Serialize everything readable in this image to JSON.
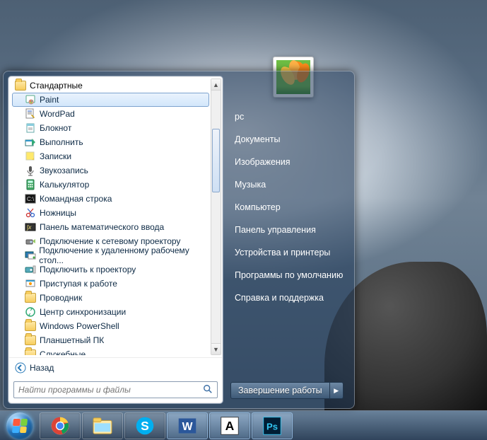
{
  "start_menu": {
    "current_folder": "Стандартные",
    "programs": [
      {
        "label": "Paint",
        "icon": "paint-icon",
        "selected": true
      },
      {
        "label": "WordPad",
        "icon": "wordpad-icon"
      },
      {
        "label": "Блокнот",
        "icon": "notepad-icon"
      },
      {
        "label": "Выполнить",
        "icon": "run-icon"
      },
      {
        "label": "Записки",
        "icon": "sticky-notes-icon"
      },
      {
        "label": "Звукозапись",
        "icon": "sound-recorder-icon"
      },
      {
        "label": "Калькулятор",
        "icon": "calculator-icon"
      },
      {
        "label": "Командная строка",
        "icon": "cmd-icon"
      },
      {
        "label": "Ножницы",
        "icon": "snipping-tool-icon"
      },
      {
        "label": "Панель математического ввода",
        "icon": "math-input-icon"
      },
      {
        "label": "Подключение к сетевому проектору",
        "icon": "network-projector-icon"
      },
      {
        "label": "Подключение к удаленному рабочему стол...",
        "icon": "remote-desktop-icon"
      },
      {
        "label": "Подключить к проектору",
        "icon": "projector-icon"
      },
      {
        "label": "Приступая к работе",
        "icon": "getting-started-icon"
      },
      {
        "label": "Проводник",
        "icon": "explorer-icon"
      },
      {
        "label": "Центр синхронизации",
        "icon": "sync-center-icon"
      },
      {
        "label": "Windows PowerShell",
        "icon": "folder-icon"
      },
      {
        "label": "Планшетный ПК",
        "icon": "folder-icon"
      },
      {
        "label": "Служебные",
        "icon": "folder-icon"
      }
    ],
    "back_label": "Назад",
    "search_placeholder": "Найти программы и файлы"
  },
  "right_panel": {
    "items": [
      "pc",
      "Документы",
      "Изображения",
      "Музыка",
      "Компьютер",
      "Панель управления",
      "Устройства и принтеры",
      "Программы по умолчанию",
      "Справка и поддержка"
    ],
    "shutdown_label": "Завершение работы"
  },
  "taskbar": {
    "items": [
      {
        "name": "chrome",
        "active": false
      },
      {
        "name": "explorer",
        "active": false
      },
      {
        "name": "skype",
        "active": false
      },
      {
        "name": "word",
        "active": true
      },
      {
        "name": "app-a",
        "active": true
      },
      {
        "name": "photoshop",
        "active": true
      }
    ]
  }
}
